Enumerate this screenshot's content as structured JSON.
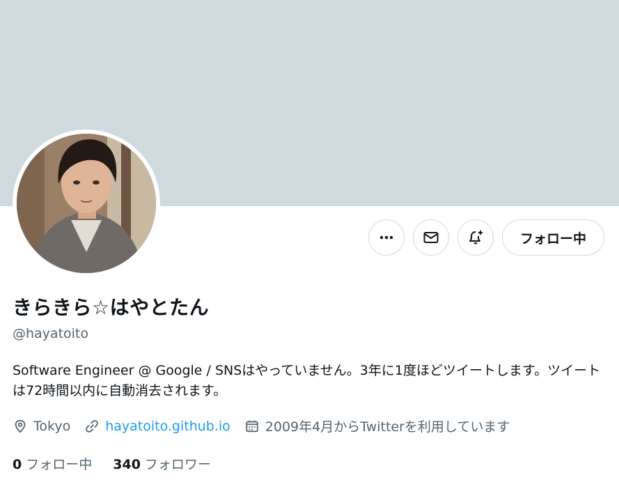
{
  "profile": {
    "display_name": "きらきら☆はやとたん",
    "handle": "@hayatoito",
    "bio": "Software Engineer @ Google / SNSはやっていません。3年に1度ほどツイートします。ツイートは72時間以内に自動消去されます。",
    "location": "Tokyo",
    "website": "hayatoito.github.io",
    "joined": "2009年4月からTwitterを利用しています"
  },
  "actions": {
    "more_icon": "more-icon",
    "message_icon": "envelope-icon",
    "notify_icon": "bell-plus-icon",
    "follow_label": "フォロー中"
  },
  "stats": {
    "following_count": "0",
    "following_label": "フォロー中",
    "followers_count": "340",
    "followers_label": "フォロワー"
  },
  "colors": {
    "banner": "#cfd9de",
    "link": "#1d9bf0",
    "secondary_text": "#536471",
    "primary_text": "#0f1419"
  }
}
